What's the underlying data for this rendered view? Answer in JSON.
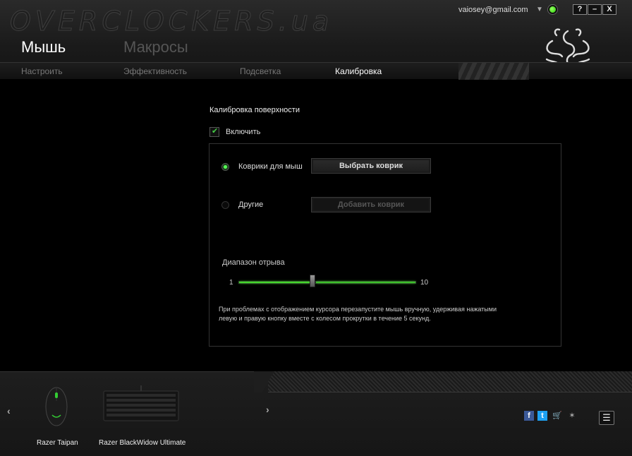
{
  "header": {
    "watermark": "OVERCLOCKERS.ua",
    "account_email": "vaiosey@gmail.com",
    "account_arrow": "▼",
    "window_buttons": {
      "help": "?",
      "minimize": "–",
      "close": "X"
    },
    "main_tabs": [
      {
        "label": "Мышь",
        "active": true
      },
      {
        "label": "Макросы",
        "active": false
      }
    ],
    "sub_tabs": [
      {
        "label": "Настроить",
        "active": false
      },
      {
        "label": "Эффективность",
        "active": false
      },
      {
        "label": "Подсветка",
        "active": false
      },
      {
        "label": "Калибровка",
        "active": true
      }
    ]
  },
  "calibration": {
    "title": "Калибровка поверхности",
    "enable_label": "Включить",
    "enable_checked": true,
    "options": [
      {
        "label": "Коврики для мыш",
        "selected": true,
        "button": "Выбрать коврик",
        "button_enabled": true
      },
      {
        "label": "Другие",
        "selected": false,
        "button": "Добавить коврик",
        "button_enabled": false
      }
    ],
    "lift_range": {
      "label": "Диапазон отрыва",
      "min_label": "1",
      "max_label": "10",
      "min": 1,
      "max": 10,
      "value": 5
    },
    "note": "При проблемах с отображением курсора перезапустите мышь вручную, удерживая нажатыми левую и правую кнопку вместе с колесом прокрутки в течение 5 секунд."
  },
  "footer": {
    "prev_arrow": "‹",
    "next_arrow": "›",
    "devices": [
      {
        "name": "Razer Taipan",
        "icon": "mouse-icon"
      },
      {
        "name": "Razer BlackWidow Ultimate",
        "icon": "keyboard-icon"
      }
    ],
    "social": [
      {
        "icon": "facebook-icon",
        "glyph": "f"
      },
      {
        "icon": "twitter-icon",
        "glyph": "t"
      },
      {
        "icon": "cart-icon",
        "glyph": "🛒"
      },
      {
        "icon": "razer-logo-icon",
        "glyph": "✶"
      }
    ],
    "menu_glyph": "☰"
  },
  "colors": {
    "accent_green": "#44d62c",
    "background": "#000000",
    "header": "#1e1e1e"
  }
}
